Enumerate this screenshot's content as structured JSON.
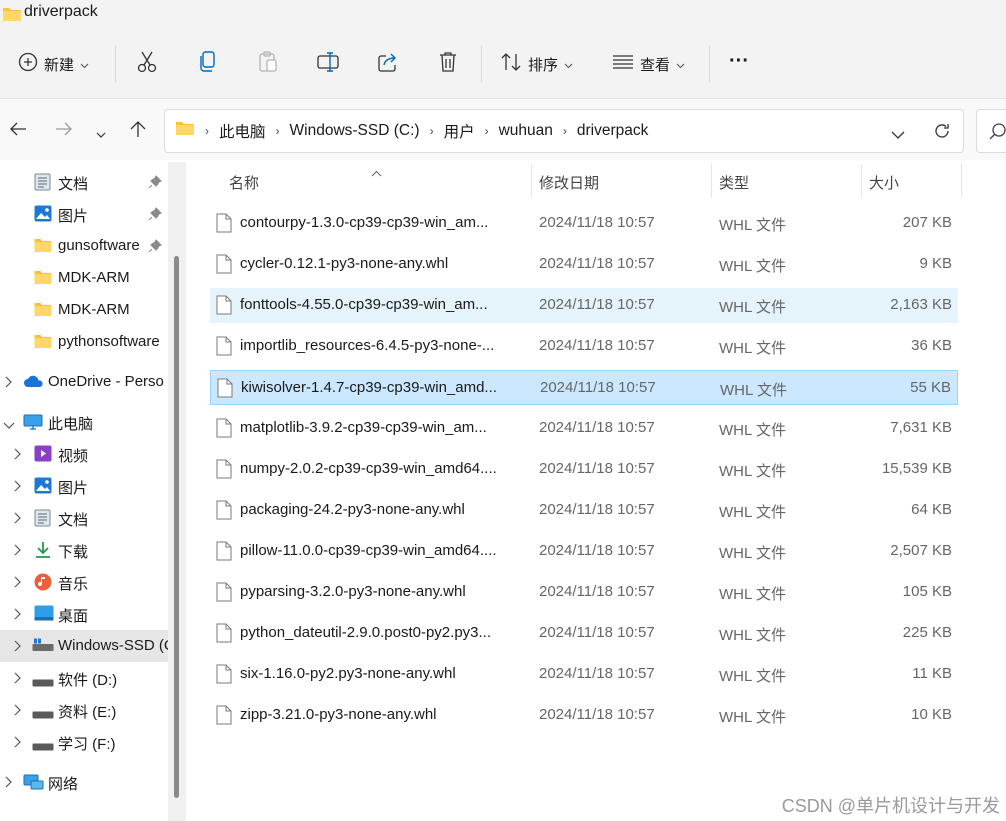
{
  "window": {
    "title": "driverpack"
  },
  "toolbar": {
    "new_label": "新建",
    "sort_label": "排序",
    "view_label": "查看",
    "more_label": "···",
    "icons": [
      "add-icon",
      "cut-icon",
      "copy-icon",
      "paste-icon",
      "rename-icon",
      "share-icon",
      "delete-icon",
      "sort-icon",
      "view-icon",
      "more-icon"
    ]
  },
  "address": {
    "breadcrumb": [
      "此电脑",
      "Windows-SSD (C:)",
      "用户",
      "wuhuan",
      "driverpack"
    ]
  },
  "sidebar": {
    "items": [
      {
        "label": "文档",
        "icon": "documents-icon",
        "pinned": true
      },
      {
        "label": "图片",
        "icon": "pictures-icon",
        "pinned": true
      },
      {
        "label": "gunsoftware",
        "icon": "folder-icon",
        "pinned": true
      },
      {
        "label": "MDK-ARM",
        "icon": "folder-icon",
        "pinned": false
      },
      {
        "label": "MDK-ARM",
        "icon": "folder-icon",
        "pinned": false
      },
      {
        "label": "pythonsoftware",
        "icon": "folder-icon",
        "pinned": false
      },
      {
        "label": "OneDrive - Perso",
        "icon": "onedrive-icon",
        "pinned": false
      },
      {
        "label": "此电脑",
        "icon": "pc-icon",
        "pinned": false
      },
      {
        "label": "视频",
        "icon": "videos-icon",
        "pinned": false
      },
      {
        "label": "图片",
        "icon": "pictures-icon",
        "pinned": false
      },
      {
        "label": "文档",
        "icon": "documents-icon",
        "pinned": false
      },
      {
        "label": "下载",
        "icon": "downloads-icon",
        "pinned": false
      },
      {
        "label": "音乐",
        "icon": "music-icon",
        "pinned": false
      },
      {
        "label": "桌面",
        "icon": "desktop-icon",
        "pinned": false
      },
      {
        "label": "Windows-SSD (C:)",
        "icon": "drive-c-icon",
        "pinned": false
      },
      {
        "label": "软件 (D:)",
        "icon": "drive-icon",
        "pinned": false
      },
      {
        "label": "资料 (E:)",
        "icon": "drive-icon",
        "pinned": false
      },
      {
        "label": "学习 (F:)",
        "icon": "drive-icon",
        "pinned": false
      },
      {
        "label": "网络",
        "icon": "network-icon",
        "pinned": false
      }
    ]
  },
  "filelist": {
    "columns": {
      "name": "名称",
      "date": "修改日期",
      "type": "类型",
      "size": "大小"
    },
    "files": [
      {
        "name": "contourpy-1.3.0-cp39-cp39-win_am...",
        "date": "2024/11/18 10:57",
        "type": "WHL 文件",
        "size": "207 KB"
      },
      {
        "name": "cycler-0.12.1-py3-none-any.whl",
        "date": "2024/11/18 10:57",
        "type": "WHL 文件",
        "size": "9 KB"
      },
      {
        "name": "fonttools-4.55.0-cp39-cp39-win_am...",
        "date": "2024/11/18 10:57",
        "type": "WHL 文件",
        "size": "2,163 KB"
      },
      {
        "name": "importlib_resources-6.4.5-py3-none-...",
        "date": "2024/11/18 10:57",
        "type": "WHL 文件",
        "size": "36 KB"
      },
      {
        "name": "kiwisolver-1.4.7-cp39-cp39-win_amd...",
        "date": "2024/11/18 10:57",
        "type": "WHL 文件",
        "size": "55 KB"
      },
      {
        "name": "matplotlib-3.9.2-cp39-cp39-win_am...",
        "date": "2024/11/18 10:57",
        "type": "WHL 文件",
        "size": "7,631 KB"
      },
      {
        "name": "numpy-2.0.2-cp39-cp39-win_amd64....",
        "date": "2024/11/18 10:57",
        "type": "WHL 文件",
        "size": "15,539 KB"
      },
      {
        "name": "packaging-24.2-py3-none-any.whl",
        "date": "2024/11/18 10:57",
        "type": "WHL 文件",
        "size": "64 KB"
      },
      {
        "name": "pillow-11.0.0-cp39-cp39-win_amd64....",
        "date": "2024/11/18 10:57",
        "type": "WHL 文件",
        "size": "2,507 KB"
      },
      {
        "name": "pyparsing-3.2.0-py3-none-any.whl",
        "date": "2024/11/18 10:57",
        "type": "WHL 文件",
        "size": "105 KB"
      },
      {
        "name": "python_dateutil-2.9.0.post0-py2.py3...",
        "date": "2024/11/18 10:57",
        "type": "WHL 文件",
        "size": "225 KB"
      },
      {
        "name": "six-1.16.0-py2.py3-none-any.whl",
        "date": "2024/11/18 10:57",
        "type": "WHL 文件",
        "size": "11 KB"
      },
      {
        "name": "zipp-3.21.0-py3-none-any.whl",
        "date": "2024/11/18 10:57",
        "type": "WHL 文件",
        "size": "10 KB"
      }
    ]
  },
  "watermark": "CSDN @单片机设计与开发",
  "colors": {
    "accent": "#0067c0",
    "hover_row": "#e5f3fb",
    "selected_row": "#cce8ff",
    "folder": "#f8c33c"
  }
}
